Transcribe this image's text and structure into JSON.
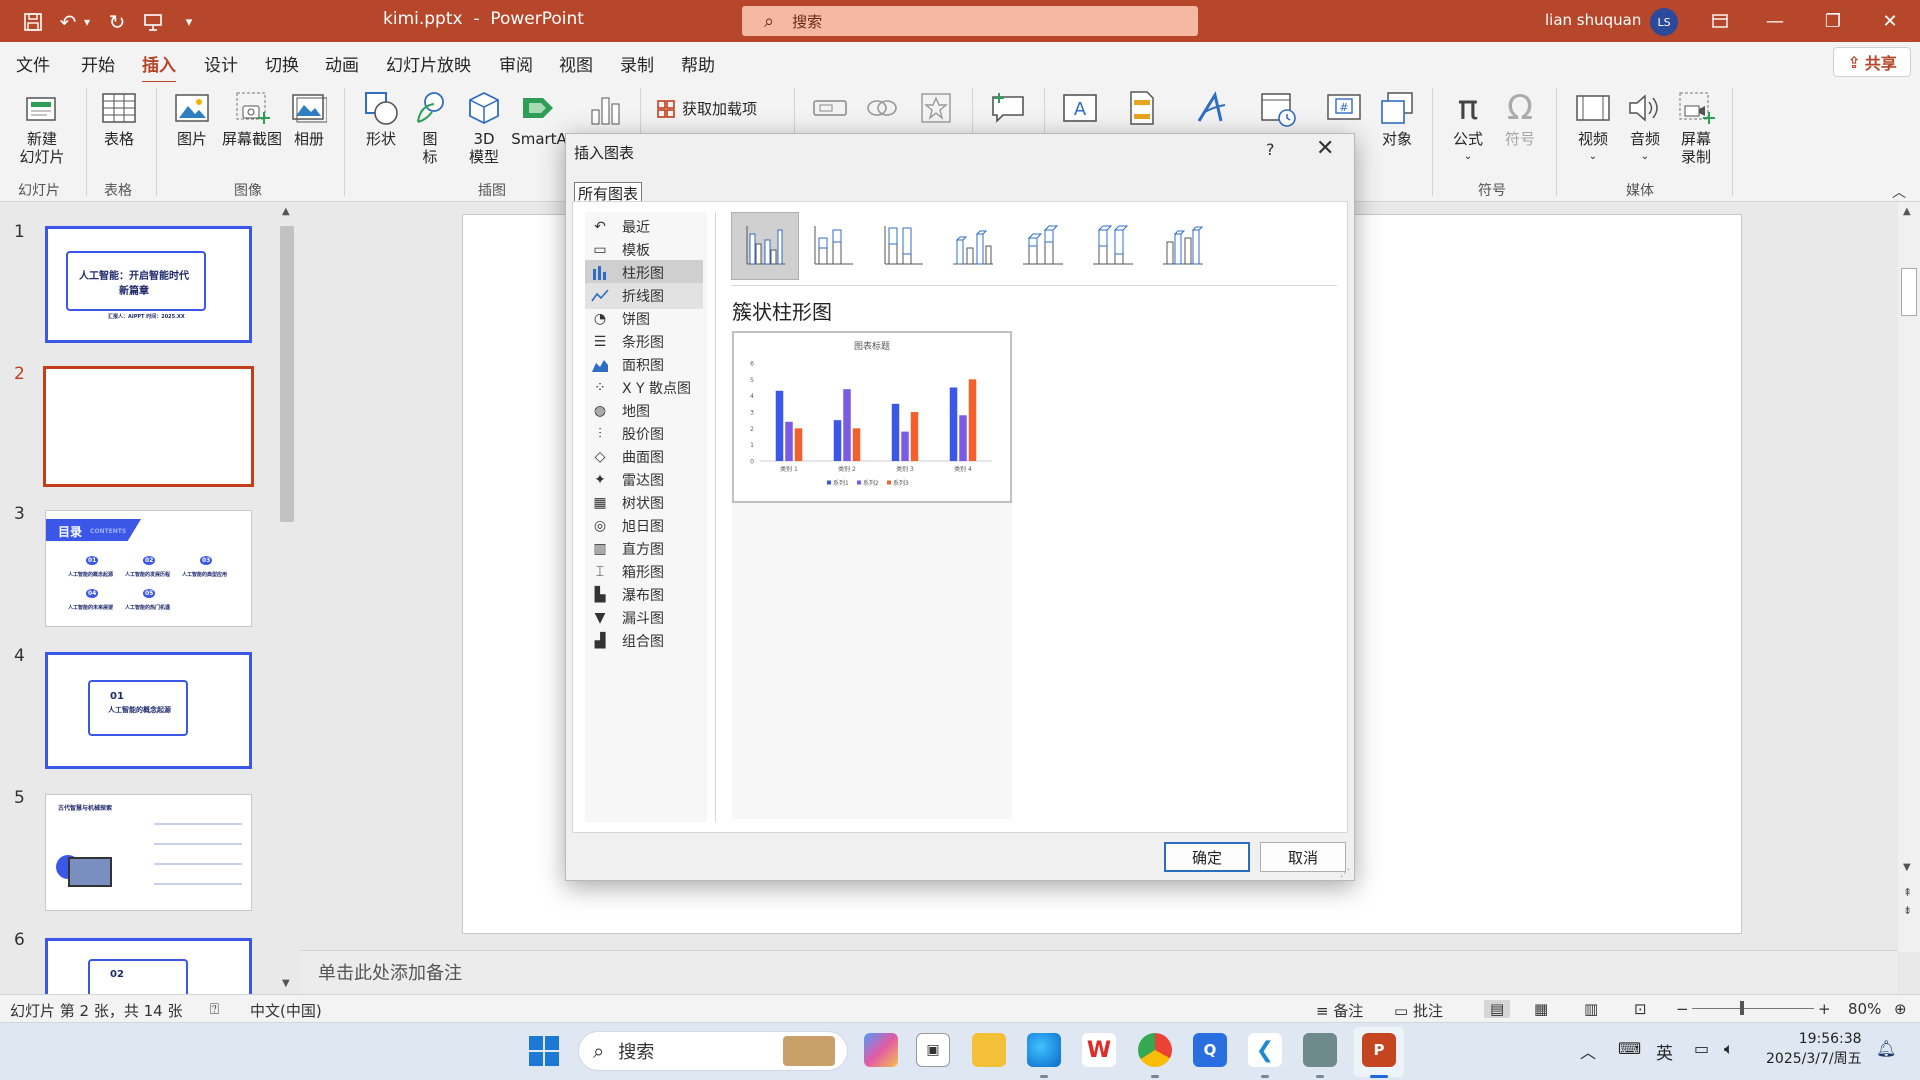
{
  "titlebar": {
    "doc_title": "kimi.pptx  -  PowerPoint",
    "search_placeholder": "搜索",
    "user_name": "lian shuquan",
    "user_initials": "LS",
    "brand_color": "#b7472a"
  },
  "tabs": [
    "文件",
    "开始",
    "插入",
    "设计",
    "切换",
    "动画",
    "幻灯片放映",
    "审阅",
    "视图",
    "录制",
    "帮助"
  ],
  "active_tab": "插入",
  "share_label": "共享",
  "ribbon": {
    "new_slide": "新建\n幻灯片",
    "table": "表格",
    "picture": "图片",
    "screenshot": "屏幕截图",
    "album": "相册",
    "shapes": "形状",
    "icons": "图\n标",
    "model3d": "3D\n模型",
    "smartart": "SmartA",
    "addins": "获取加载项",
    "object": "对象",
    "equation": "公式",
    "symbol": "符号",
    "video": "视频",
    "audio": "音频",
    "screen_record": "屏幕\n录制",
    "groups": {
      "slides": "幻灯片",
      "tables": "表格",
      "images": "图像",
      "illustrations": "插图",
      "symbols": "符号",
      "media": "媒体"
    }
  },
  "thumbnails": {
    "numbers": [
      "1",
      "2",
      "3",
      "4",
      "5",
      "6"
    ],
    "active_index": 2,
    "slide1_title": "人工智能：开启智能时代\n新篇章",
    "slide1_sub": "汇报人：AIPPT    时间：2025.XX",
    "slide3_header": "目录",
    "slide3_contents": "CONTENTS",
    "slide3_items": [
      "人工智能的概念起源",
      "人工智能的发展历程",
      "人工智能的典型应用",
      "人工智能的未来展望",
      "人工智能的热门机遇"
    ],
    "slide3_nums": [
      "01",
      "02",
      "03",
      "04",
      "05"
    ],
    "slide4_num": "01",
    "slide4_title": "人工智能的概念起源",
    "slide5_title": "古代智慧与机械探索",
    "slide6_num": "02"
  },
  "notes_placeholder": "单击此处添加备注",
  "statusbar": {
    "slide_info": "幻灯片 第 2 张，共 14 张",
    "language": "中文(中国)",
    "notes_btn": "备注",
    "comments_btn": "批注",
    "zoom": "80%"
  },
  "dialog": {
    "title": "插入图表",
    "help": "?",
    "all_charts_tab": "所有图表",
    "categories": [
      "最近",
      "模板",
      "柱形图",
      "折线图",
      "饼图",
      "条形图",
      "面积图",
      "X Y 散点图",
      "地图",
      "股价图",
      "曲面图",
      "雷达图",
      "树状图",
      "旭日图",
      "直方图",
      "箱形图",
      "瀑布图",
      "漏斗图",
      "组合图"
    ],
    "selected_category": "柱形图",
    "hovered_category": "折线图",
    "subtype_name": "簇状柱形图",
    "ok_label": "确定",
    "cancel_label": "取消"
  },
  "chart_data": {
    "type": "bar",
    "title": "图表标题",
    "categories": [
      "类别 1",
      "类别 2",
      "类别 3",
      "类别 4"
    ],
    "series": [
      {
        "name": "系列1",
        "values": [
          4.3,
          2.5,
          3.5,
          4.5
        ],
        "color": "#3a57e8"
      },
      {
        "name": "系列2",
        "values": [
          2.4,
          4.4,
          1.8,
          2.8
        ],
        "color": "#7b5be6"
      },
      {
        "name": "系列3",
        "values": [
          2.0,
          2.0,
          3.0,
          5.0
        ],
        "color": "#f4602c"
      }
    ],
    "ylim": [
      0,
      6
    ],
    "yticks": [
      "0",
      "1",
      "2",
      "3",
      "4",
      "5",
      "6"
    ],
    "legend": "bottom",
    "grid": false
  },
  "taskbar": {
    "search_placeholder": "搜索",
    "ime": "英",
    "time": "19:56:38",
    "date": "2025/3/7/周五"
  }
}
